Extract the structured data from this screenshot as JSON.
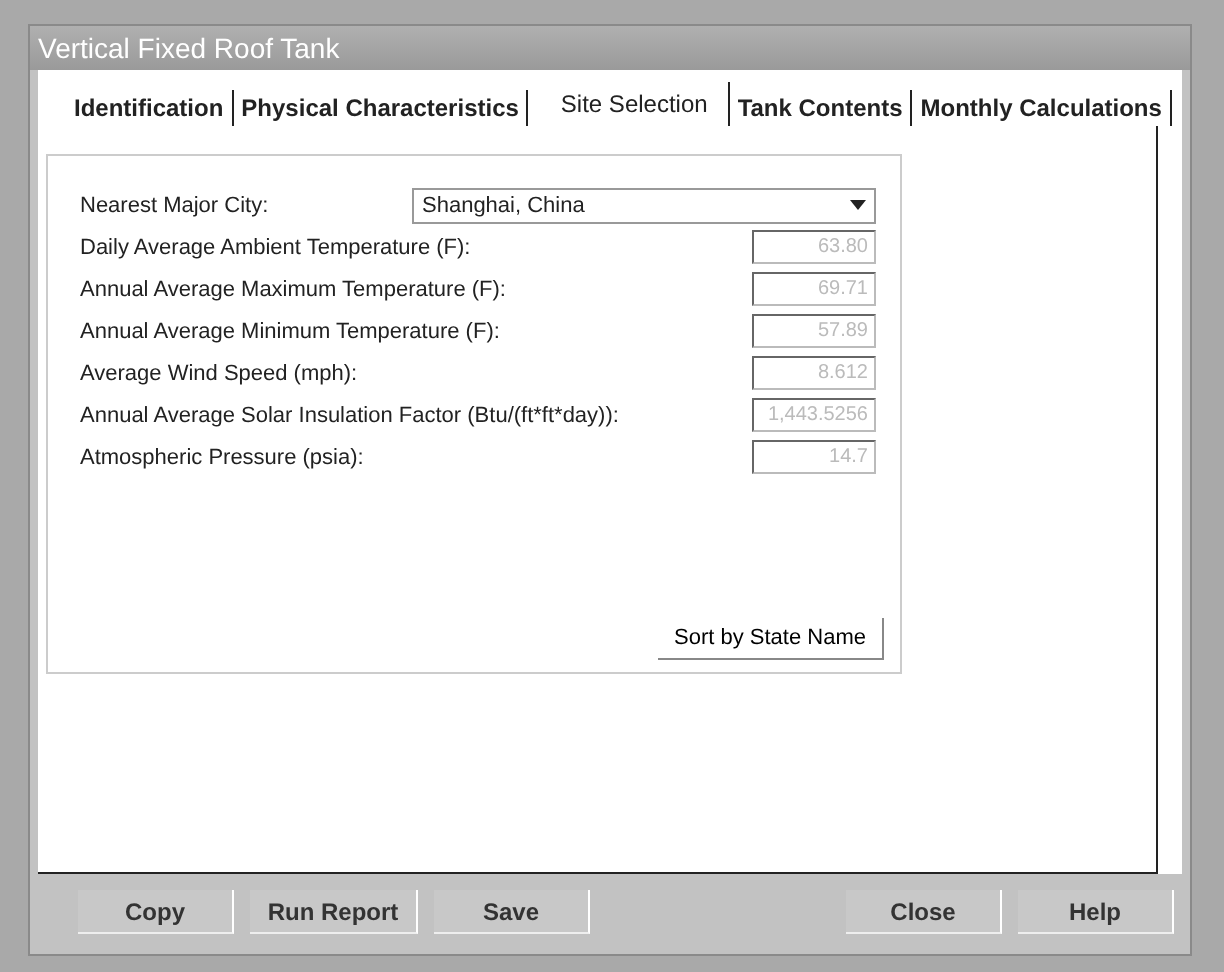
{
  "window": {
    "title": "Vertical Fixed Roof Tank"
  },
  "tabs": [
    {
      "label": "Identification",
      "selected": false
    },
    {
      "label": "Physical Characteristics",
      "selected": false
    },
    {
      "label": "Site Selection",
      "selected": true
    },
    {
      "label": "Tank Contents",
      "selected": false
    },
    {
      "label": "Monthly Calculations",
      "selected": false
    }
  ],
  "city": {
    "label": "Nearest Major City:",
    "value": "Shanghai, China"
  },
  "fields": [
    {
      "label": "Daily Average Ambient Temperature (F):",
      "value": "63.80",
      "disabled": true
    },
    {
      "label": "Annual Average Maximum Temperature (F):",
      "value": "69.71",
      "disabled": true
    },
    {
      "label": "Annual Average Minimum Temperature (F):",
      "value": "57.89",
      "disabled": true
    },
    {
      "label": "Average Wind Speed (mph):",
      "value": "8.612",
      "disabled": true
    },
    {
      "label": "Annual Average Solar Insulation Factor (Btu/(ft*ft*day)):",
      "value": "1,443.5256",
      "disabled": true
    },
    {
      "label": "Atmospheric Pressure (psia):",
      "value": "14.7",
      "disabled": true
    }
  ],
  "sort_button": "Sort by State Name",
  "buttons_left": [
    "Copy",
    "Run Report",
    "Save"
  ],
  "buttons_right": [
    "Close",
    "Help"
  ]
}
